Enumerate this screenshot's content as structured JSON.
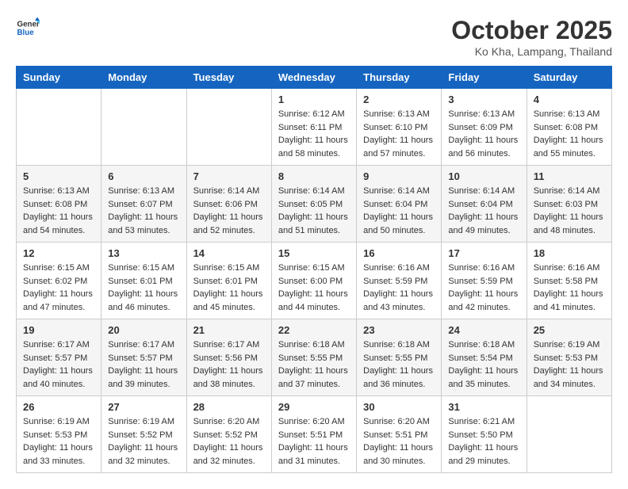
{
  "header": {
    "logo_line1": "General",
    "logo_line2": "Blue",
    "month": "October 2025",
    "location": "Ko Kha, Lampang, Thailand"
  },
  "weekdays": [
    "Sunday",
    "Monday",
    "Tuesday",
    "Wednesday",
    "Thursday",
    "Friday",
    "Saturday"
  ],
  "weeks": [
    [
      {
        "day": "",
        "sunrise": "",
        "sunset": "",
        "daylight": ""
      },
      {
        "day": "",
        "sunrise": "",
        "sunset": "",
        "daylight": ""
      },
      {
        "day": "",
        "sunrise": "",
        "sunset": "",
        "daylight": ""
      },
      {
        "day": "1",
        "sunrise": "Sunrise: 6:12 AM",
        "sunset": "Sunset: 6:11 PM",
        "daylight": "Daylight: 11 hours and 58 minutes."
      },
      {
        "day": "2",
        "sunrise": "Sunrise: 6:13 AM",
        "sunset": "Sunset: 6:10 PM",
        "daylight": "Daylight: 11 hours and 57 minutes."
      },
      {
        "day": "3",
        "sunrise": "Sunrise: 6:13 AM",
        "sunset": "Sunset: 6:09 PM",
        "daylight": "Daylight: 11 hours and 56 minutes."
      },
      {
        "day": "4",
        "sunrise": "Sunrise: 6:13 AM",
        "sunset": "Sunset: 6:08 PM",
        "daylight": "Daylight: 11 hours and 55 minutes."
      }
    ],
    [
      {
        "day": "5",
        "sunrise": "Sunrise: 6:13 AM",
        "sunset": "Sunset: 6:08 PM",
        "daylight": "Daylight: 11 hours and 54 minutes."
      },
      {
        "day": "6",
        "sunrise": "Sunrise: 6:13 AM",
        "sunset": "Sunset: 6:07 PM",
        "daylight": "Daylight: 11 hours and 53 minutes."
      },
      {
        "day": "7",
        "sunrise": "Sunrise: 6:14 AM",
        "sunset": "Sunset: 6:06 PM",
        "daylight": "Daylight: 11 hours and 52 minutes."
      },
      {
        "day": "8",
        "sunrise": "Sunrise: 6:14 AM",
        "sunset": "Sunset: 6:05 PM",
        "daylight": "Daylight: 11 hours and 51 minutes."
      },
      {
        "day": "9",
        "sunrise": "Sunrise: 6:14 AM",
        "sunset": "Sunset: 6:04 PM",
        "daylight": "Daylight: 11 hours and 50 minutes."
      },
      {
        "day": "10",
        "sunrise": "Sunrise: 6:14 AM",
        "sunset": "Sunset: 6:04 PM",
        "daylight": "Daylight: 11 hours and 49 minutes."
      },
      {
        "day": "11",
        "sunrise": "Sunrise: 6:14 AM",
        "sunset": "Sunset: 6:03 PM",
        "daylight": "Daylight: 11 hours and 48 minutes."
      }
    ],
    [
      {
        "day": "12",
        "sunrise": "Sunrise: 6:15 AM",
        "sunset": "Sunset: 6:02 PM",
        "daylight": "Daylight: 11 hours and 47 minutes."
      },
      {
        "day": "13",
        "sunrise": "Sunrise: 6:15 AM",
        "sunset": "Sunset: 6:01 PM",
        "daylight": "Daylight: 11 hours and 46 minutes."
      },
      {
        "day": "14",
        "sunrise": "Sunrise: 6:15 AM",
        "sunset": "Sunset: 6:01 PM",
        "daylight": "Daylight: 11 hours and 45 minutes."
      },
      {
        "day": "15",
        "sunrise": "Sunrise: 6:15 AM",
        "sunset": "Sunset: 6:00 PM",
        "daylight": "Daylight: 11 hours and 44 minutes."
      },
      {
        "day": "16",
        "sunrise": "Sunrise: 6:16 AM",
        "sunset": "Sunset: 5:59 PM",
        "daylight": "Daylight: 11 hours and 43 minutes."
      },
      {
        "day": "17",
        "sunrise": "Sunrise: 6:16 AM",
        "sunset": "Sunset: 5:59 PM",
        "daylight": "Daylight: 11 hours and 42 minutes."
      },
      {
        "day": "18",
        "sunrise": "Sunrise: 6:16 AM",
        "sunset": "Sunset: 5:58 PM",
        "daylight": "Daylight: 11 hours and 41 minutes."
      }
    ],
    [
      {
        "day": "19",
        "sunrise": "Sunrise: 6:17 AM",
        "sunset": "Sunset: 5:57 PM",
        "daylight": "Daylight: 11 hours and 40 minutes."
      },
      {
        "day": "20",
        "sunrise": "Sunrise: 6:17 AM",
        "sunset": "Sunset: 5:57 PM",
        "daylight": "Daylight: 11 hours and 39 minutes."
      },
      {
        "day": "21",
        "sunrise": "Sunrise: 6:17 AM",
        "sunset": "Sunset: 5:56 PM",
        "daylight": "Daylight: 11 hours and 38 minutes."
      },
      {
        "day": "22",
        "sunrise": "Sunrise: 6:18 AM",
        "sunset": "Sunset: 5:55 PM",
        "daylight": "Daylight: 11 hours and 37 minutes."
      },
      {
        "day": "23",
        "sunrise": "Sunrise: 6:18 AM",
        "sunset": "Sunset: 5:55 PM",
        "daylight": "Daylight: 11 hours and 36 minutes."
      },
      {
        "day": "24",
        "sunrise": "Sunrise: 6:18 AM",
        "sunset": "Sunset: 5:54 PM",
        "daylight": "Daylight: 11 hours and 35 minutes."
      },
      {
        "day": "25",
        "sunrise": "Sunrise: 6:19 AM",
        "sunset": "Sunset: 5:53 PM",
        "daylight": "Daylight: 11 hours and 34 minutes."
      }
    ],
    [
      {
        "day": "26",
        "sunrise": "Sunrise: 6:19 AM",
        "sunset": "Sunset: 5:53 PM",
        "daylight": "Daylight: 11 hours and 33 minutes."
      },
      {
        "day": "27",
        "sunrise": "Sunrise: 6:19 AM",
        "sunset": "Sunset: 5:52 PM",
        "daylight": "Daylight: 11 hours and 32 minutes."
      },
      {
        "day": "28",
        "sunrise": "Sunrise: 6:20 AM",
        "sunset": "Sunset: 5:52 PM",
        "daylight": "Daylight: 11 hours and 32 minutes."
      },
      {
        "day": "29",
        "sunrise": "Sunrise: 6:20 AM",
        "sunset": "Sunset: 5:51 PM",
        "daylight": "Daylight: 11 hours and 31 minutes."
      },
      {
        "day": "30",
        "sunrise": "Sunrise: 6:20 AM",
        "sunset": "Sunset: 5:51 PM",
        "daylight": "Daylight: 11 hours and 30 minutes."
      },
      {
        "day": "31",
        "sunrise": "Sunrise: 6:21 AM",
        "sunset": "Sunset: 5:50 PM",
        "daylight": "Daylight: 11 hours and 29 minutes."
      },
      {
        "day": "",
        "sunrise": "",
        "sunset": "",
        "daylight": ""
      }
    ]
  ]
}
